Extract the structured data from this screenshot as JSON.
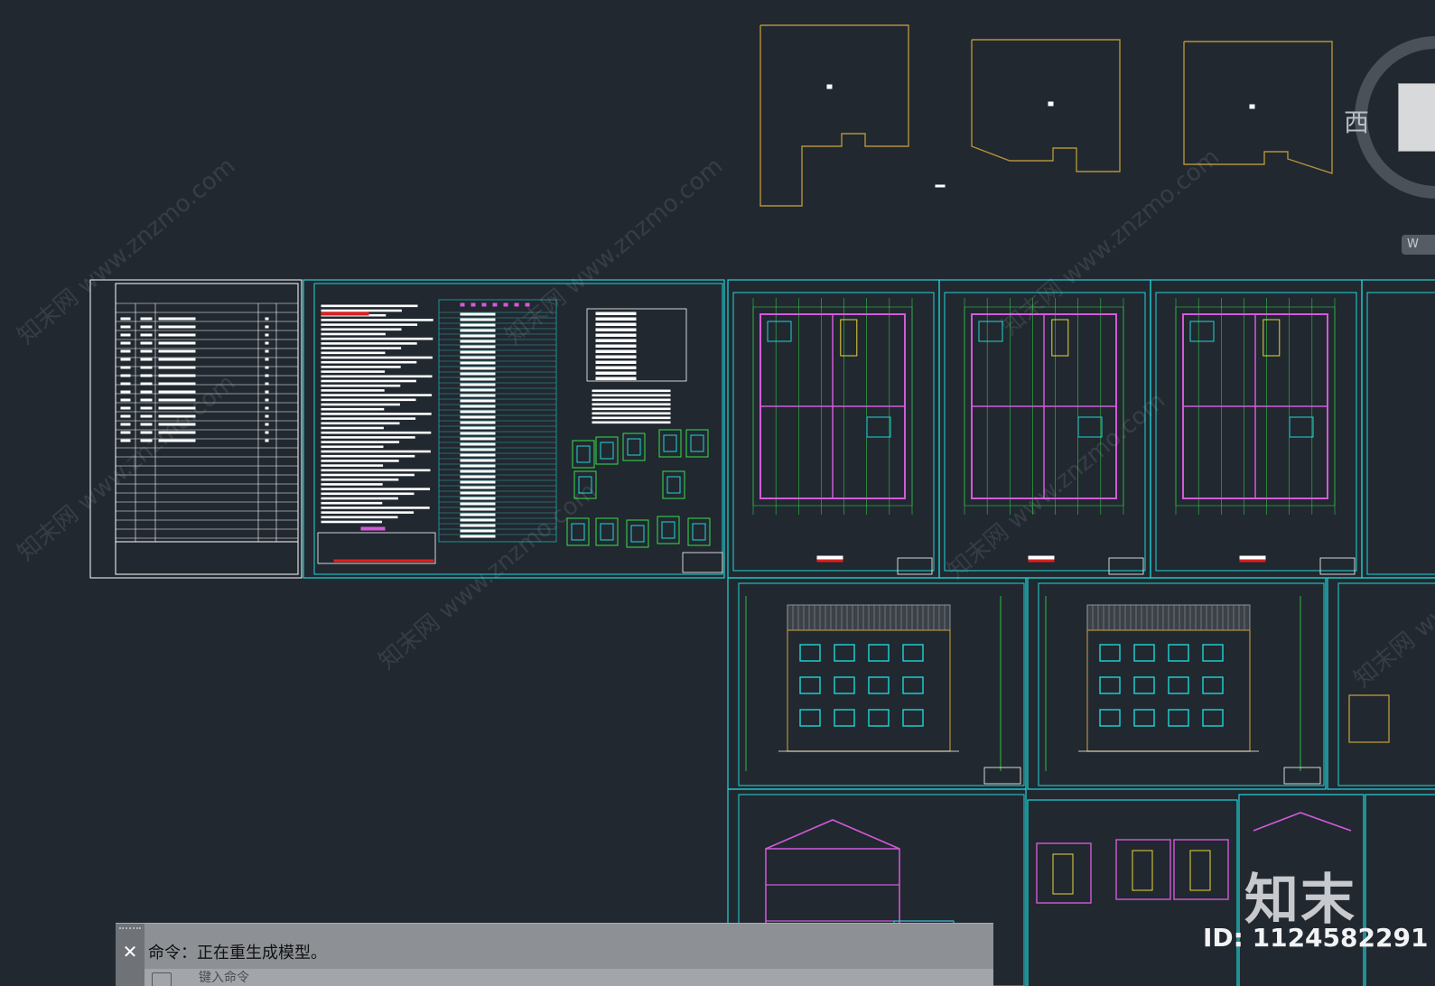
{
  "viewcube": {
    "west_label": "西",
    "wcs_label": "W"
  },
  "watermark": {
    "text": "知末网 www.znzmo.com"
  },
  "brand": {
    "logo_text": "知末",
    "id_text": "ID: 1124582291"
  },
  "command_line": {
    "history": "命令：正在重生成模型。",
    "input_placeholder": "键入命令"
  },
  "colors": {
    "background": "#212830",
    "frame_cyan": "#1fd6d6",
    "outline_gold": "#b3913a",
    "dim_green": "#36e04a",
    "wall_magenta": "#d35ad8",
    "white": "#ffffff"
  }
}
